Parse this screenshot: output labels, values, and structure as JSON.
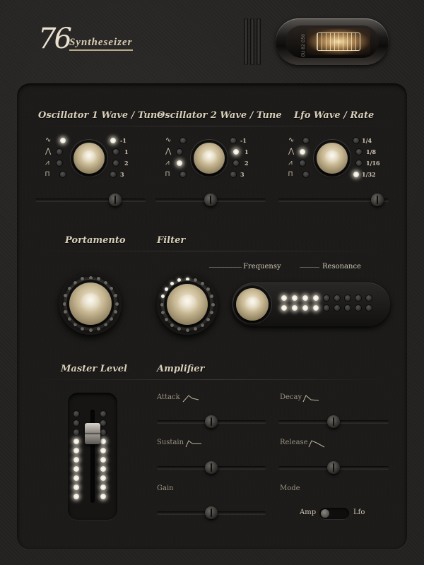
{
  "header": {
    "logo_number": "76",
    "logo_name": "Syntheseizer",
    "tube_label": "GU 82 G50"
  },
  "osc1": {
    "title": "Oscillator 1 Wave / Tune",
    "tune_labels": [
      "-1",
      "1",
      "2",
      "3"
    ],
    "wave_icons": [
      "sine-icon",
      "triangle-icon",
      "saw-icon",
      "square-icon"
    ],
    "active_wave": 0,
    "active_tune": 0,
    "slider_value": 0.75
  },
  "osc2": {
    "title": "Oscillator 2 Wave / Tune",
    "tune_labels": [
      "-1",
      "1",
      "2",
      "3"
    ],
    "wave_icons": [
      "sine-icon",
      "triangle-icon",
      "saw-icon",
      "square-icon"
    ],
    "active_wave": 2,
    "active_tune": 1,
    "slider_value": 0.5
  },
  "lfo": {
    "title": "Lfo Wave / Rate",
    "rate_labels": [
      "1/4",
      "1/8",
      "1/16",
      "1/32"
    ],
    "wave_icons": [
      "sine-icon",
      "triangle-icon",
      "saw-icon",
      "square-icon"
    ],
    "active_wave": 1,
    "active_rate": 3,
    "slider_value": 0.95
  },
  "portamento": {
    "title": "Portamento"
  },
  "filter": {
    "title": "Filter",
    "frequency_label": "Frequensy",
    "resonance_label": "Resonance",
    "resonance_level": 4
  },
  "master": {
    "title": "Master Level",
    "level": 0.72
  },
  "amplifier": {
    "title": "Amplifier",
    "attack_label": "Attack",
    "decay_label": "Decay",
    "sustain_label": "Sustain",
    "release_label": "Release",
    "gain_label": "Gain",
    "mode_label": "Mode",
    "mode_left": "Amp",
    "mode_right": "Lfo",
    "attack": 0.5,
    "decay": 0.5,
    "sustain": 0.5,
    "release": 0.5,
    "gain": 0.5
  },
  "colors": {
    "accent": "#f4f1e8",
    "brass": "#c9b994",
    "panel": "#1b1a18"
  }
}
